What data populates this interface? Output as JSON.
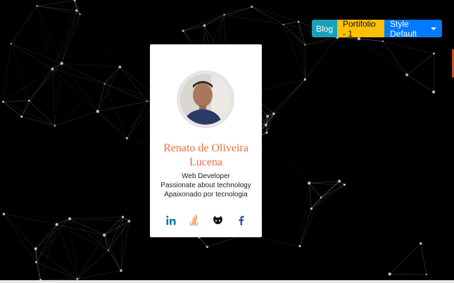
{
  "topbar": {
    "blog_label": "Blog",
    "portfolio_label": "Portifolio - 1",
    "style_label": "Style Default"
  },
  "profile": {
    "name": "Renato de Oliveira Lucena",
    "lines": [
      "Web Developer",
      "Passionate about technology",
      "Apaixonado por tecnologia"
    ]
  },
  "socials": [
    "linkedin-icon",
    "stackoverflow-icon",
    "github-icon",
    "facebook-icon"
  ],
  "colors": {
    "name": "#ef6c3b",
    "blog": "#17a2b8",
    "portfolio": "#ffc107",
    "style": "#007bff",
    "linkedin": "#0e76a8",
    "stackoverflow": "#f48024",
    "facebook": "#3b5998"
  }
}
